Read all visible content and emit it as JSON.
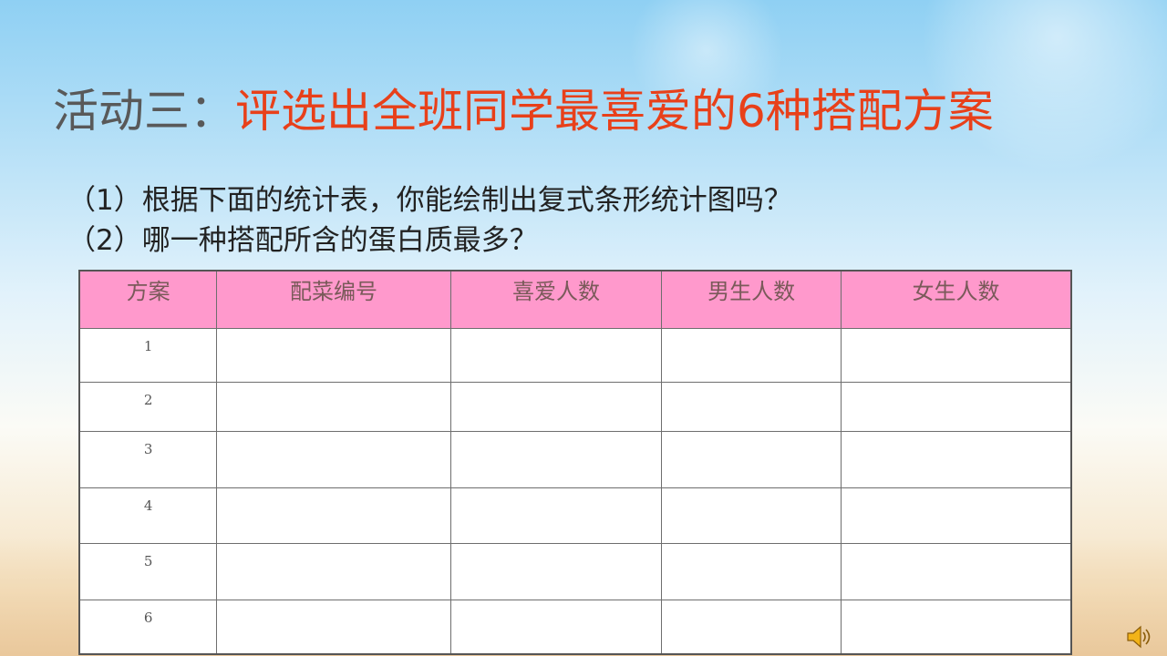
{
  "title": {
    "prefix": "活动三：",
    "main": "评选出全班同学最喜爱的6种搭配方案"
  },
  "questions": [
    "（1）根据下面的统计表，你能绘制出复式条形统计图吗？",
    "（2）哪一种搭配所含的蛋白质最多？"
  ],
  "table": {
    "headers": [
      "方案",
      "配菜编号",
      "喜爱人数",
      "男生人数",
      "女生人数"
    ],
    "rows": [
      "1",
      "2",
      "3",
      "4",
      "5",
      "6"
    ]
  },
  "colors": {
    "title_accent": "#e8401a",
    "header_fill": "#ff99cc"
  },
  "icons": {
    "audio": "speaker-icon"
  }
}
